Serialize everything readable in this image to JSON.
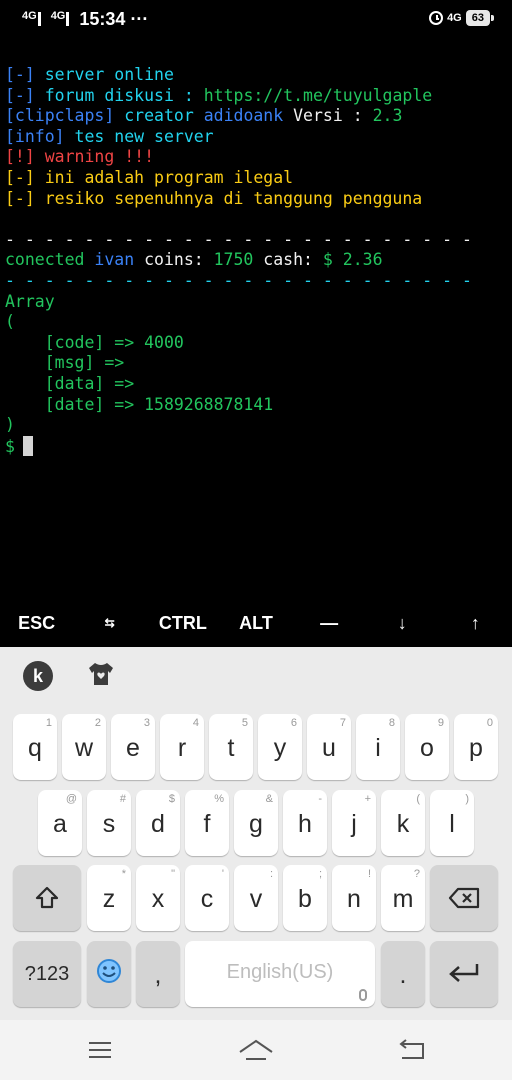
{
  "status_bar": {
    "network1": "4G",
    "network2": "4G",
    "time": "15:34",
    "more": "···",
    "network3": "4G",
    "battery": "63"
  },
  "terminal": {
    "lines": [
      [
        {
          "t": "[-] ",
          "c": "c-blue"
        },
        {
          "t": "server online",
          "c": "c-cyan"
        }
      ],
      [
        {
          "t": "[-] ",
          "c": "c-blue"
        },
        {
          "t": "forum diskusi : ",
          "c": "c-cyan"
        },
        {
          "t": "https://t.me/tuyulgaple",
          "c": "c-green"
        }
      ],
      [
        {
          "t": "[clipclaps] ",
          "c": "c-blue"
        },
        {
          "t": "creator ",
          "c": "c-cyan"
        },
        {
          "t": "adidoank ",
          "c": "c-blue"
        },
        {
          "t": "Versi : ",
          "c": "c-white"
        },
        {
          "t": "2.3",
          "c": "c-green"
        }
      ],
      [
        {
          "t": "[info] ",
          "c": "c-blue"
        },
        {
          "t": "tes new server",
          "c": "c-cyan"
        }
      ],
      [
        {
          "t": "[!] ",
          "c": "c-red"
        },
        {
          "t": "warning !!!",
          "c": "c-red"
        }
      ],
      [
        {
          "t": "[-] ",
          "c": "c-yellow"
        },
        {
          "t": "ini adalah program ilegal",
          "c": "c-yellow"
        }
      ],
      [
        {
          "t": "[-] ",
          "c": "c-yellow"
        },
        {
          "t": "resiko sepenuhnya di tanggung pengguna",
          "c": "c-yellow"
        }
      ],
      [
        {
          "t": "",
          "c": "c-white"
        }
      ],
      [
        {
          "t": "- - - - - - - - - - - - - - - - - - - - - - - -",
          "c": "c-white"
        }
      ],
      [
        {
          "t": "conected ",
          "c": "c-green"
        },
        {
          "t": "ivan ",
          "c": "c-blue"
        },
        {
          "t": "coins: ",
          "c": "c-white"
        },
        {
          "t": "1750 ",
          "c": "c-green"
        },
        {
          "t": "cash: ",
          "c": "c-white"
        },
        {
          "t": "$ 2.36",
          "c": "c-green"
        }
      ],
      [
        {
          "t": "- - - - - - - - - - - - - - - - - - - - - - - -",
          "c": "c-cyan"
        }
      ],
      [
        {
          "t": "Array",
          "c": "c-green"
        }
      ],
      [
        {
          "t": "(",
          "c": "c-green"
        }
      ],
      [
        {
          "t": "    [code] => 4000",
          "c": "c-green"
        }
      ],
      [
        {
          "t": "    [msg] =>",
          "c": "c-green"
        }
      ],
      [
        {
          "t": "    [data] =>",
          "c": "c-green"
        }
      ],
      [
        {
          "t": "    [date] => 1589268878141",
          "c": "c-green"
        }
      ],
      [
        {
          "t": ")",
          "c": "c-green"
        }
      ]
    ],
    "prompt": "$"
  },
  "extra_keys": [
    "ESC",
    "⇆",
    "CTRL",
    "ALT",
    "—",
    "↓",
    "↑"
  ],
  "keyboard": {
    "row1": [
      {
        "k": "q",
        "h": "1"
      },
      {
        "k": "w",
        "h": "2"
      },
      {
        "k": "e",
        "h": "3"
      },
      {
        "k": "r",
        "h": "4"
      },
      {
        "k": "t",
        "h": "5"
      },
      {
        "k": "y",
        "h": "6"
      },
      {
        "k": "u",
        "h": "7"
      },
      {
        "k": "i",
        "h": "8"
      },
      {
        "k": "o",
        "h": "9"
      },
      {
        "k": "p",
        "h": "0"
      }
    ],
    "row2": [
      {
        "k": "a",
        "h": "@"
      },
      {
        "k": "s",
        "h": "#"
      },
      {
        "k": "d",
        "h": "$"
      },
      {
        "k": "f",
        "h": "%"
      },
      {
        "k": "g",
        "h": "&"
      },
      {
        "k": "h",
        "h": "-"
      },
      {
        "k": "j",
        "h": "+"
      },
      {
        "k": "k",
        "h": "("
      },
      {
        "k": "l",
        "h": ")"
      }
    ],
    "row3": [
      {
        "k": "z",
        "h": "*"
      },
      {
        "k": "x",
        "h": "\""
      },
      {
        "k": "c",
        "h": "'"
      },
      {
        "k": "v",
        "h": ":"
      },
      {
        "k": "b",
        "h": ";"
      },
      {
        "k": "n",
        "h": "!"
      },
      {
        "k": "m",
        "h": "?"
      }
    ],
    "num_key": "?123",
    "comma": ",",
    "space_label": "English(US)",
    "period": "."
  }
}
